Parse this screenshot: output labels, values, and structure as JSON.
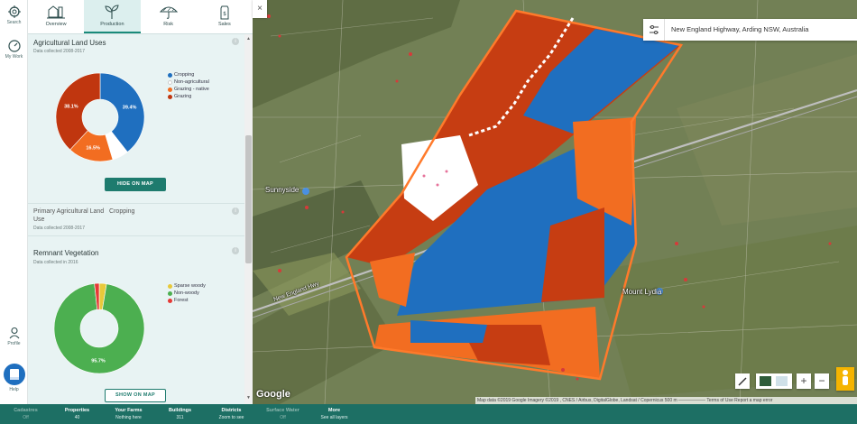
{
  "rail": {
    "items": [
      {
        "label": "Search"
      },
      {
        "label": "My Work"
      },
      {
        "label": "Profile"
      },
      {
        "label": "Help"
      }
    ]
  },
  "tabs": [
    {
      "label": "Overview"
    },
    {
      "label": "Production"
    },
    {
      "label": "Risk"
    },
    {
      "label": "Sales"
    }
  ],
  "land_uses": {
    "title": "Agricultural Land Uses",
    "subtitle": "Data collected 2008-2017",
    "legend": [
      "Cropping",
      "Non-agricultural",
      "Grazing - native",
      "Grazing"
    ],
    "button": "HIDE ON MAP",
    "colors": {
      "cropping": "#1f6fbf",
      "non_agricultural": "#ffffff",
      "grazing_native": "#f26d21",
      "grazing": "#c0360f"
    }
  },
  "chart_data": [
    {
      "type": "pie",
      "title": "Agricultural Land Uses",
      "categories": [
        "Cropping",
        "Non-agricultural",
        "Grazing - native",
        "Grazing"
      ],
      "values": [
        39.4,
        6.0,
        16.5,
        38.1
      ],
      "data_labels": [
        "39.4%",
        "",
        "16.5%",
        "38.1%"
      ]
    },
    {
      "type": "pie",
      "title": "Remnant Vegetation",
      "categories": [
        "Sparse woody",
        "Non-woody",
        "Forest"
      ],
      "values": [
        2.6,
        95.7,
        1.7
      ],
      "data_labels": [
        "",
        "95.7%",
        ""
      ]
    }
  ],
  "primary_use": {
    "label": "Primary Agricultural Land",
    "value": "Cropping",
    "value_cont": "Use",
    "subtitle": "Data collected 2008-2017"
  },
  "remnant": {
    "title": "Remnant Vegetation",
    "subtitle": "Data collected in 2016",
    "legend": [
      "Sparse woody",
      "Non-woody",
      "Forest"
    ],
    "button": "SHOW ON MAP",
    "colors": {
      "sparse": "#e8c93a",
      "nonwoody": "#4caf50",
      "forest": "#e53935"
    }
  },
  "map": {
    "search": "New England Highway, Arding NSW, Australia",
    "labels": {
      "sunnyside": "Sunnyside",
      "highway": "New England Hwy",
      "mount": "Mount Lydia"
    },
    "google": "Google",
    "attribution": "Map data ©2019 Google Imagery ©2019 , CNES / Airbus, DigitalGlobe, Landsat / Copernicus   500 m ——————   Terms of Use   Report a map error"
  },
  "bottom_bar": [
    {
      "label": "Cadastres",
      "value": "Off",
      "disabled": true
    },
    {
      "label": "Properties",
      "value": "40",
      "disabled": false
    },
    {
      "label": "Your Farms",
      "value": "Nothing here",
      "disabled": false
    },
    {
      "label": "Buildings",
      "value": "311",
      "disabled": false
    },
    {
      "label": "Districts",
      "value": "Zoom to see",
      "disabled": false
    },
    {
      "label": "Surface Water",
      "value": "Off",
      "disabled": true
    },
    {
      "label": "More",
      "value": "See all layers",
      "disabled": false
    }
  ]
}
